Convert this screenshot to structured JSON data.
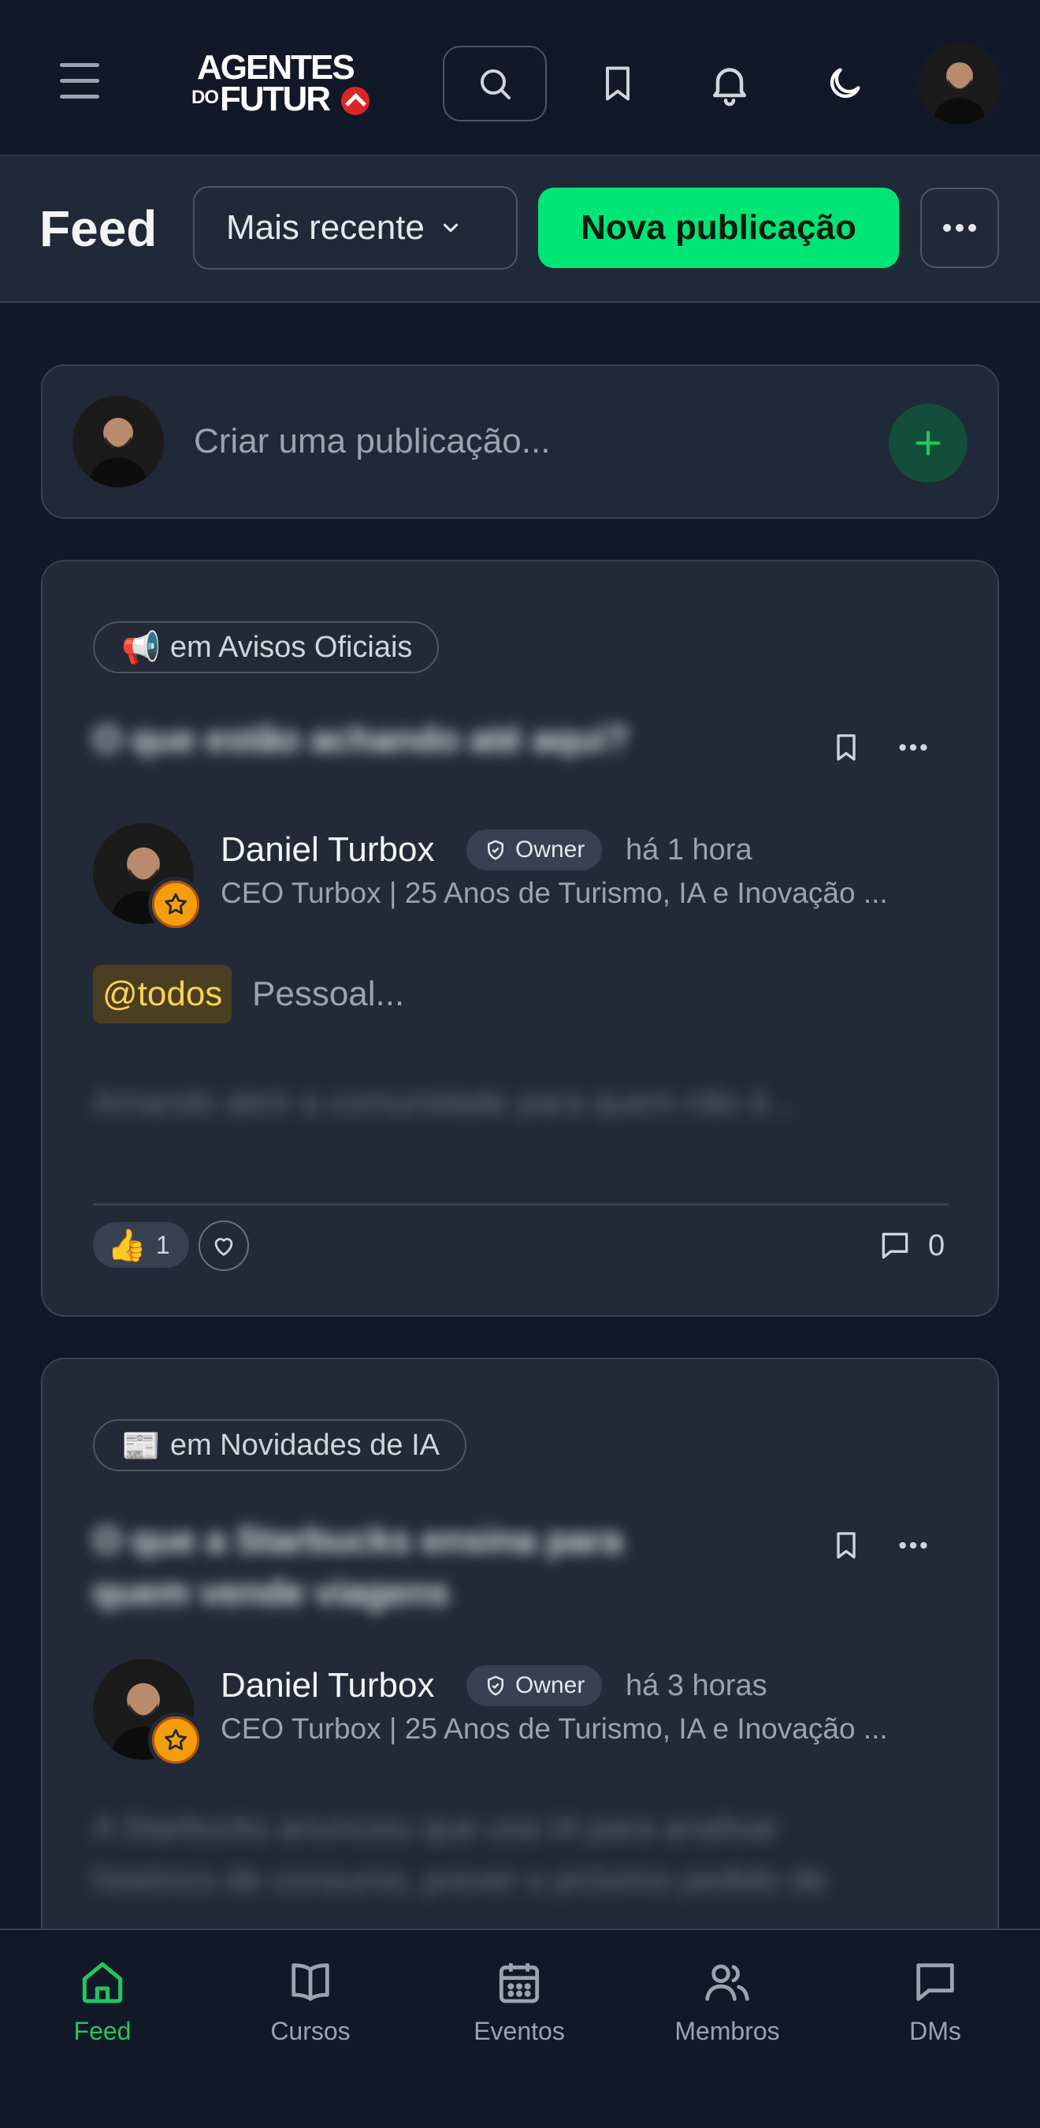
{
  "header": {
    "logo_line1": "AGENTES",
    "logo_line2_prefix": "DO",
    "logo_line2": "FUTUR",
    "icons": [
      "menu-icon",
      "search-icon",
      "bookmark-icon",
      "bell-icon",
      "moon-icon"
    ]
  },
  "toolbar": {
    "title": "Feed",
    "sort_value": "Mais recente",
    "new_post_label": "Nova publicação"
  },
  "composer": {
    "placeholder": "Criar uma publicação..."
  },
  "posts": [
    {
      "space_emoji": "📢",
      "space": "em Avisos Oficiais",
      "title": "O que estão achando até aqui?",
      "author": "Daniel Turbox",
      "role": "Owner",
      "time": "há 1 hora",
      "bio": "CEO Turbox | 25 Anos de Turismo, IA e Inovação ...",
      "mention": "@todos",
      "body": "Pessoal...",
      "blurred_line": "Amando abrir a comunidade para quem não é...",
      "reaction_emoji": "👍",
      "reaction_count": "1",
      "comment_count": "0"
    },
    {
      "space_emoji": "📰",
      "space": "em Novidades de IA",
      "title_line1": "O que a Starbucks ensina para",
      "title_line2": "quem vende viagens",
      "author": "Daniel Turbox",
      "role": "Owner",
      "time": "há 3 horas",
      "bio": "CEO Turbox | 25 Anos de Turismo, IA e Inovação ...",
      "blurred_line1": "A Starbucks anunciou que usa IA para analisar",
      "blurred_line2": "histórico de consumo, prever o próximo pedido de"
    }
  ],
  "bottom_nav": [
    {
      "label": "Feed",
      "icon": "home-icon",
      "active": true
    },
    {
      "label": "Cursos",
      "icon": "book-icon",
      "active": false
    },
    {
      "label": "Eventos",
      "icon": "calendar-icon",
      "active": false
    },
    {
      "label": "Membros",
      "icon": "users-icon",
      "active": false
    },
    {
      "label": "DMs",
      "icon": "chat-icon",
      "active": false
    }
  ],
  "colors": {
    "accent": "#00e676",
    "background": "#111827",
    "card": "#222a38",
    "mention_bg": "#4a3f22",
    "mention_text": "#fcd34d",
    "badge_gold": "#f59e0b"
  }
}
